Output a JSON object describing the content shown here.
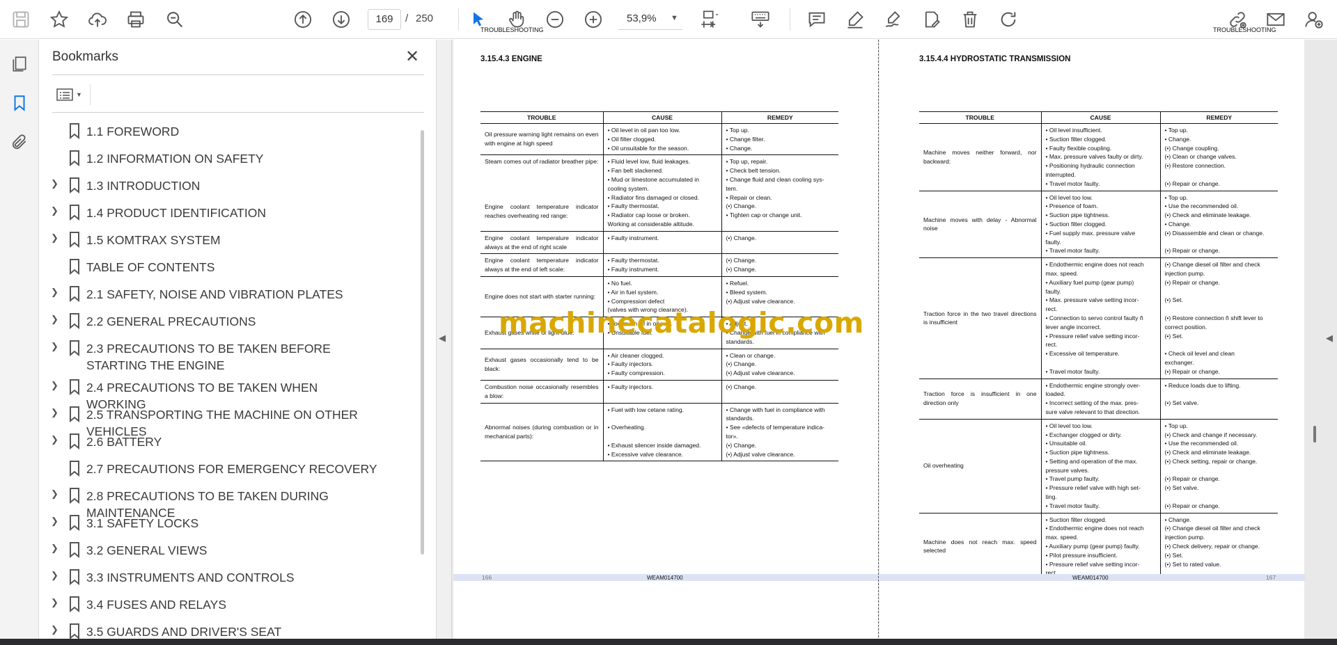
{
  "toolbar": {
    "page_current": "169",
    "page_total": "250",
    "zoom": "53,9%"
  },
  "bookmarks": {
    "title": "Bookmarks",
    "close_glyph": "✕",
    "items": [
      {
        "label": "1.1 FOREWORD",
        "expandable": false
      },
      {
        "label": "1.2 INFORMATION ON SAFETY",
        "expandable": false
      },
      {
        "label": "1.3 INTRODUCTION",
        "expandable": true
      },
      {
        "label": "1.4 PRODUCT IDENTIFICATION",
        "expandable": true
      },
      {
        "label": "1.5 KOMTRAX SYSTEM",
        "expandable": true
      },
      {
        "label": "TABLE OF CONTENTS",
        "expandable": false
      },
      {
        "label": "2.1 SAFETY, NOISE AND VIBRATION PLATES",
        "expandable": true
      },
      {
        "label": "2.2 GENERAL PRECAUTIONS",
        "expandable": true
      },
      {
        "label": "2.3 PRECAUTIONS TO BE TAKEN BEFORE STARTING THE ENGINE",
        "expandable": true
      },
      {
        "label": "2.4 PRECAUTIONS TO BE TAKEN WHEN WORKING",
        "expandable": true
      },
      {
        "label": "2.5 TRANSPORTING THE MACHINE ON OTHER VEHICLES",
        "expandable": true
      },
      {
        "label": "2.6 BATTERY",
        "expandable": true
      },
      {
        "label": "2.7 PRECAUTIONS FOR EMERGENCY RECOVERY",
        "expandable": false
      },
      {
        "label": "2.8 PRECAUTIONS TO BE TAKEN DURING MAINTENANCE",
        "expandable": true
      },
      {
        "label": "3.1 SAFETY LOCKS",
        "expandable": true
      },
      {
        "label": "3.2 GENERAL VIEWS",
        "expandable": true
      },
      {
        "label": "3.3 INSTRUMENTS AND CONTROLS",
        "expandable": true
      },
      {
        "label": "3.4 FUSES AND RELAYS",
        "expandable": true
      },
      {
        "label": "3.5 GUARDS AND DRIVER'S SEAT",
        "expandable": true
      }
    ]
  },
  "left_page": {
    "header": "TROUBLESHOOTING",
    "section": "3.15.4.3  ENGINE",
    "columns": [
      "TROUBLE",
      "CAUSE",
      "REMEDY"
    ],
    "rows": [
      {
        "trouble": "Oil pressure warning light remains on even with engine at high speed",
        "cause": [
          "•  Oil level in oil pan too low.",
          "•  Oil filter clogged.",
          "•  Oil unsuitable for the season."
        ],
        "remedy": [
          "•  Top up.",
          "•  Change filter.",
          "•  Change."
        ]
      },
      {
        "trouble": "Steam comes out of radiator breather pipe:",
        "trouble2": "Engine coolant temperature indicator reaches overheating red range:",
        "cause": [
          "•  Fluid level low, fluid leakages.",
          "•  Fan belt slackened.",
          "•  Mud or limestone accumulated in",
          "    cooling system.",
          "•  Radiator fins damaged or closed.",
          "•  Faulty thermostat.",
          "•  Radiator cap loose or broken.",
          "    Working at considerable altitude."
        ],
        "remedy": [
          "•  Top up, repair.",
          "•  Check belt tension.",
          "•  Change fluid and clean cooling sys-",
          "    tem.",
          "•  Repair or clean.",
          "(•) Change.",
          "•  Tighten cap or change unit.",
          ""
        ]
      },
      {
        "trouble": "Engine coolant temperature indicator always at the end of right scale",
        "cause": [
          "•  Faulty instrument."
        ],
        "remedy": [
          "(•) Change."
        ]
      },
      {
        "trouble": "Engine coolant temperature indicator always at the end of left scale:",
        "cause": [
          "•  Faulty thermostat.",
          "•  Faulty instrument."
        ],
        "remedy": [
          "(•) Change.",
          "(•) Change."
        ]
      },
      {
        "trouble": "Engine does not start with starter running:",
        "cause": [
          "•  No fuel.",
          "•  Air in fuel system.",
          "•  Compression defect",
          "    (valves with wrong clearance)."
        ],
        "remedy": [
          "•  Refuel.",
          "•  Bleed system.",
          "(•) Adjust valve clearance.",
          ""
        ]
      },
      {
        "trouble": "Exhaust gases white or light-blue:",
        "cause": [
          "•  Too much oil in oil pan.",
          "•  Unsuitable fuel.",
          ""
        ],
        "remedy": [
          "•  Adjust.",
          "•  Change with fuel in compliance with",
          "    standards."
        ]
      },
      {
        "trouble": "Exhaust gases occasionally tend to be black:",
        "cause": [
          "•  Air cleaner clogged.",
          "•  Faulty injectors.",
          "•  Faulty compression."
        ],
        "remedy": [
          "•  Clean or change.",
          "(•) Change.",
          "(•) Adjust valve clearance."
        ]
      },
      {
        "trouble": "Combustion noise occasionally resembles a blow:",
        "cause": [
          "•  Faulty injectors."
        ],
        "remedy": [
          "(•) Change."
        ]
      },
      {
        "trouble": "Abnormal noises (during combustion or in mechanical parts):",
        "cause": [
          "•  Fuel with low cetane rating.",
          "",
          "•  Overheating.",
          "",
          "•  Exhaust silencer inside damaged.",
          "•  Excessive valve clearance."
        ],
        "remedy": [
          "•  Change with fuel in compliance with",
          "    standards.",
          "•  See «defects of temperature indica-",
          "    tor».",
          "(•) Change.",
          "(•) Adjust valve clearance."
        ]
      }
    ],
    "page_number": "166",
    "code": "WEAM014700"
  },
  "right_page": {
    "header": "TROUBLESHOOTING",
    "section": "3.15.4.4  HYDROSTATIC TRANSMISSION",
    "columns": [
      "TROUBLE",
      "CAUSE",
      "REMEDY"
    ],
    "rows": [
      {
        "trouble": "Machine moves neither forward, nor backward:",
        "cause": [
          "•  Oil level insufficient.",
          "•  Suction filter clogged.",
          "•  Faulty flexible coupling.",
          "•  Max. pressure valves faulty or dirty.",
          "•  Positioning hydraulic connection",
          "    interrupted.",
          "•  Travel motor faulty."
        ],
        "remedy": [
          "•  Top up.",
          "•  Change.",
          "(•) Change coupling.",
          "(•) Clean or change valves.",
          "(•) Restore connection.",
          "",
          "(•) Repair or change."
        ]
      },
      {
        "trouble": "Machine moves with delay - Abnormal noise",
        "cause": [
          "•  Oil level too low.",
          "•  Presence of foam.",
          "•  Suction pipe tightness.",
          "•  Suction filter clogged.",
          "•  Fuel supply max. pressure valve",
          "    faulty.",
          "•  Travel motor faulty."
        ],
        "remedy": [
          "•  Top up.",
          "•  Use the recommended oil.",
          "(•) Check and eliminate leakage.",
          "•  Change.",
          "(•) Disassemble and clean or change.",
          "",
          "(•) Repair or change."
        ]
      },
      {
        "trouble": "Traction force in the two travel directions is insufficient",
        "cause": [
          "•  Endothermic engine does not reach",
          "    max. speed.",
          "•  Auxiliary fuel pump (gear pump)",
          "    faulty.",
          "•  Max. pressure valve setting incor-",
          "    rect.",
          "•  Connection to servo control faulty ñ",
          "    lever angle incorrect.",
          "•  Pressure relief valve setting incor-",
          "    rect.",
          "•  Excessive oil temperature.",
          "",
          "•  Travel motor faulty."
        ],
        "remedy": [
          "(•) Change diesel oil filter and check",
          "    injection pump.",
          "(•) Repair or change.",
          "",
          "(•) Set.",
          "",
          "(•) Restore connection ñ shift lever to",
          "    correct position.",
          "(•) Set.",
          "",
          "•  Check oil level and clean",
          "    exchanger.",
          "(•) Repair or change."
        ]
      },
      {
        "trouble": "Traction force is insufficient in one direction only",
        "cause": [
          "•  Endothermic engine strongly over-",
          "    loaded.",
          "•  Incorrect setting of the max. pres-",
          "    sure valve relevant to that direction."
        ],
        "remedy": [
          "•  Reduce loads due to lifting.",
          "",
          "(•) Set valve.",
          ""
        ]
      },
      {
        "trouble": "Oil overheating",
        "cause": [
          "•  Oil level too low.",
          "•  Exchanger clogged or dirty.",
          "•  Unsuitable oil.",
          "•  Suction pipe tightness.",
          "•  Setting and operation of the max.",
          "    pressure valves.",
          "•  Travel pump faulty.",
          "•  Pressure relief valve with high set-",
          "    ting.",
          "•  Travel motor faulty."
        ],
        "remedy": [
          "•  Top up.",
          "(•) Check and change if necessary.",
          "•  Use the recommended oil.",
          "(•) Check and eliminate leakage.",
          "(•) Check setting, repair or change.",
          "",
          "(•) Repair or change.",
          "(•) Set valve.",
          "",
          "(•) Repair or change."
        ]
      },
      {
        "trouble": "Machine does not reach max. speed selected",
        "cause": [
          "•  Suction filter clogged.",
          "•  Endothermic engine does not reach",
          "    max. speed.",
          "•  Auxiliary pump (gear pump) faulty.",
          "•  Pilot pressure insufficient.",
          "•  Pressure relief valve setting incor-",
          "    rect."
        ],
        "remedy": [
          "•  Change.",
          "(•) Change diesel oil filter and check",
          "    injection pump.",
          "(•) Check delivery, repair or change.",
          "(•) Set.",
          "(•) Set to rated value.",
          ""
        ]
      }
    ],
    "page_number": "167",
    "code": "WEAM014700"
  },
  "watermark": "machinecatalogic.com"
}
